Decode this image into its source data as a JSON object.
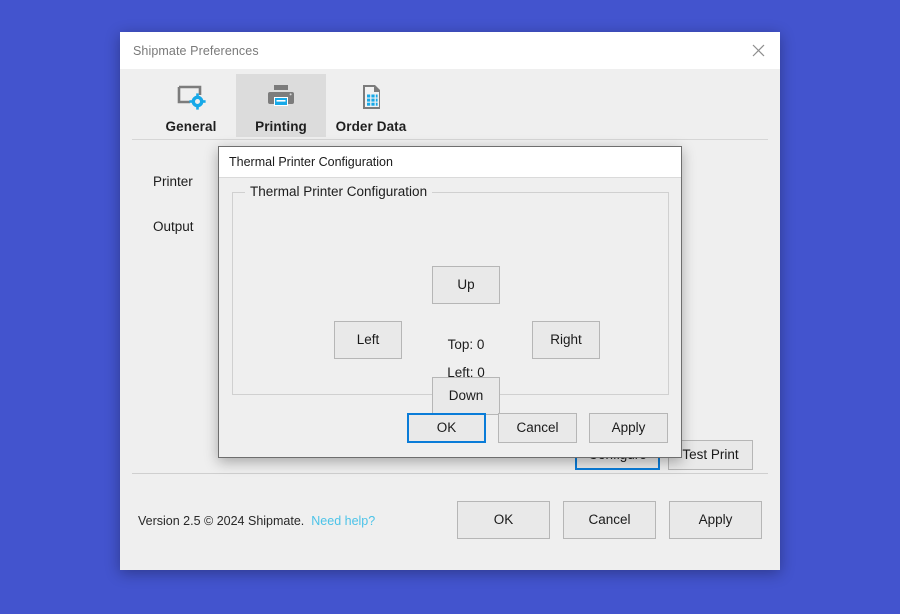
{
  "desktop": {
    "background_color": "#4354ce"
  },
  "preferences_window": {
    "title": "Shipmate Preferences",
    "close_icon": "close-icon",
    "tabs": [
      {
        "label": "General",
        "icon": "window-gear-icon",
        "selected": false
      },
      {
        "label": "Printing",
        "icon": "printer-icon",
        "selected": true
      },
      {
        "label": "Order Data",
        "icon": "document-table-icon",
        "selected": false
      }
    ],
    "form_rows": [
      {
        "label": "Printer"
      },
      {
        "label": "Output"
      }
    ],
    "actions": [
      {
        "label": "Configure",
        "focused": true
      },
      {
        "label": "Test Print",
        "focused": false
      }
    ],
    "footer": {
      "version_text": "Version 2.5 © 2024 Shipmate.",
      "help_link": "Need help?",
      "help_link_color": "#4cc3e8",
      "buttons": [
        {
          "label": "OK"
        },
        {
          "label": "Cancel"
        },
        {
          "label": "Apply"
        }
      ]
    }
  },
  "thermal_dialog": {
    "title": "Thermal Printer Configuration",
    "group_legend": "Thermal Printer Configuration",
    "dpad": {
      "up": "Up",
      "left": "Left",
      "right": "Right",
      "down": "Down"
    },
    "readout": {
      "top": "Top: 0",
      "left": "Left: 0"
    },
    "buttons": [
      {
        "label": "OK",
        "focused": true
      },
      {
        "label": "Cancel",
        "focused": false
      },
      {
        "label": "Apply",
        "focused": false
      }
    ],
    "focus_color": "#0a7cd8"
  }
}
